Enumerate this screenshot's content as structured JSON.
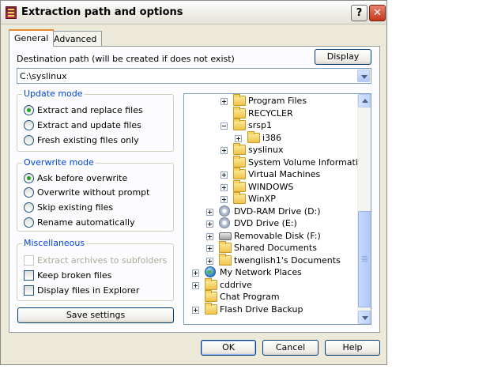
{
  "window": {
    "title": "Extraction path and options",
    "help_button": "?"
  },
  "tabs": [
    "General",
    "Advanced"
  ],
  "destination": {
    "label": "Destination path (will be created if does not exist)",
    "value": "C:\\syslinux",
    "display_button": "Display"
  },
  "update_mode": {
    "title": "Update mode",
    "options": [
      {
        "label": "Extract and replace files",
        "checked": true
      },
      {
        "label": "Extract and update files",
        "checked": false
      },
      {
        "label": "Fresh existing files only",
        "checked": false
      }
    ]
  },
  "overwrite_mode": {
    "title": "Overwrite mode",
    "options": [
      {
        "label": "Ask before overwrite",
        "checked": true
      },
      {
        "label": "Overwrite without prompt",
        "checked": false
      },
      {
        "label": "Skip existing files",
        "checked": false
      },
      {
        "label": "Rename automatically",
        "checked": false
      }
    ]
  },
  "misc": {
    "title": "Miscellaneous",
    "options": [
      {
        "label": "Extract archives to subfolders",
        "checked": false,
        "disabled": true
      },
      {
        "label": "Keep broken files",
        "checked": false,
        "disabled": false
      },
      {
        "label": "Display files in Explorer",
        "checked": false,
        "disabled": false
      }
    ]
  },
  "save_settings": "Save settings",
  "tree": [
    {
      "label": "Program Files",
      "icon": "folder-icon",
      "expander": "plus",
      "level": 2
    },
    {
      "label": "RECYCLER",
      "icon": "folder-icon",
      "expander": "none",
      "level": 2
    },
    {
      "label": "srsp1",
      "icon": "folder-icon",
      "expander": "minus",
      "level": 2
    },
    {
      "label": "i386",
      "icon": "folder-icon",
      "expander": "plus",
      "level": 3
    },
    {
      "label": "syslinux",
      "icon": "folder-icon",
      "expander": "plus",
      "level": 2
    },
    {
      "label": "System Volume Information",
      "icon": "folder-icon",
      "expander": "none",
      "level": 2
    },
    {
      "label": "Virtual Machines",
      "icon": "folder-icon",
      "expander": "plus",
      "level": 2
    },
    {
      "label": "WINDOWS",
      "icon": "folder-icon",
      "expander": "plus",
      "level": 2
    },
    {
      "label": "WinXP",
      "icon": "folder-icon",
      "expander": "plus",
      "level": 2
    },
    {
      "label": "DVD-RAM Drive (D:)",
      "icon": "disc-icon",
      "expander": "plus",
      "level": 1
    },
    {
      "label": "DVD Drive (E:)",
      "icon": "disc-icon",
      "expander": "plus",
      "level": 1
    },
    {
      "label": "Removable Disk (F:)",
      "icon": "removable-drive-icon",
      "expander": "plus",
      "level": 1
    },
    {
      "label": "Shared Documents",
      "icon": "folder-icon",
      "expander": "plus",
      "level": 1
    },
    {
      "label": "twenglish1's Documents",
      "icon": "folder-icon",
      "expander": "plus",
      "level": 1
    },
    {
      "label": "My Network Places",
      "icon": "network-globe-icon",
      "expander": "plus",
      "level": 0
    },
    {
      "label": "cddrive",
      "icon": "folder-icon",
      "expander": "plus",
      "level": 0
    },
    {
      "label": "Chat Program",
      "icon": "folder-icon",
      "expander": "none",
      "level": 0
    },
    {
      "label": "Flash Drive Backup",
      "icon": "folder-icon",
      "expander": "plus",
      "level": 0
    }
  ],
  "buttons": {
    "ok": "OK",
    "cancel": "Cancel",
    "help": "Help"
  }
}
